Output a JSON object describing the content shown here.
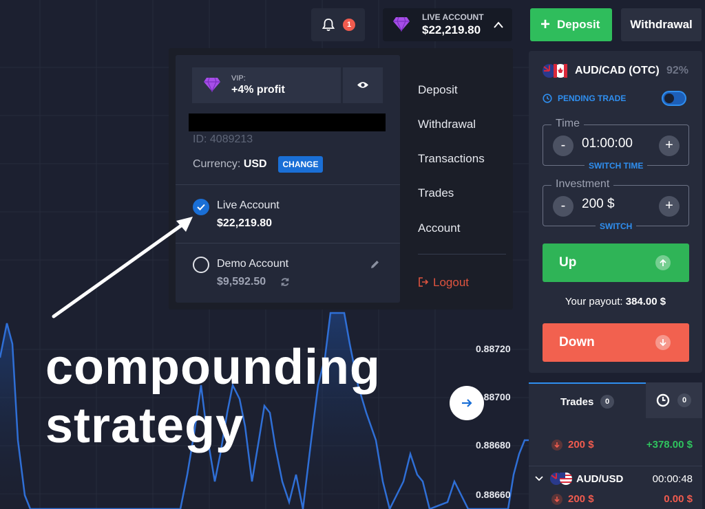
{
  "topbar": {
    "notification_count": "1",
    "account_label": "LIVE ACCOUNT",
    "account_balance": "$22,219.80",
    "deposit_label": "Deposit",
    "withdrawal_label": "Withdrawal"
  },
  "chart": {
    "price_labels": [
      "0.88720",
      "0.88700",
      "0.88680",
      "0.88660"
    ],
    "line_color": "#2f6fd6"
  },
  "dropdown": {
    "vip_label": "VIP:",
    "vip_profit": "+4% profit",
    "account_id": "ID: 4089213",
    "currency_label": "Currency:",
    "currency_value": "USD",
    "change_label": "CHANGE",
    "accounts": [
      {
        "name": "Live Account",
        "balance": "$22,219.80",
        "selected": true
      },
      {
        "name": "Demo Account",
        "balance": "$9,592.50",
        "selected": false
      }
    ],
    "menu": [
      "Deposit",
      "Withdrawal",
      "Transactions",
      "Trades",
      "Account"
    ],
    "logout_label": "Logout"
  },
  "overlay": {
    "line1": "compounding",
    "line2": "strategy"
  },
  "trade": {
    "pair": "AUD/CAD (OTC)",
    "payout_pct": "92%",
    "pending_label": "PENDING TRADE",
    "time_label": "Time",
    "time_value": "01:00:00",
    "time_switch": "SWITCH TIME",
    "investment_label": "Investment",
    "investment_value": "200 $",
    "investment_switch": "SWITCH",
    "up_label": "Up",
    "down_label": "Down",
    "payout_label": "Your payout:",
    "payout_value": "384.00 $",
    "accent": "#2f8ff0",
    "up_color": "#2fb457",
    "down_color": "#f2614f"
  },
  "trades_panel": {
    "tab_trades": "Trades",
    "trades_count": "0",
    "clock_count": "0",
    "rows": [
      {
        "pair": "",
        "amount": "200 $",
        "profit": "+378.00 $",
        "timer": ""
      },
      {
        "pair": "AUD/USD",
        "amount": "200 $",
        "profit": "0.00 $",
        "timer": "00:00:48"
      }
    ]
  }
}
